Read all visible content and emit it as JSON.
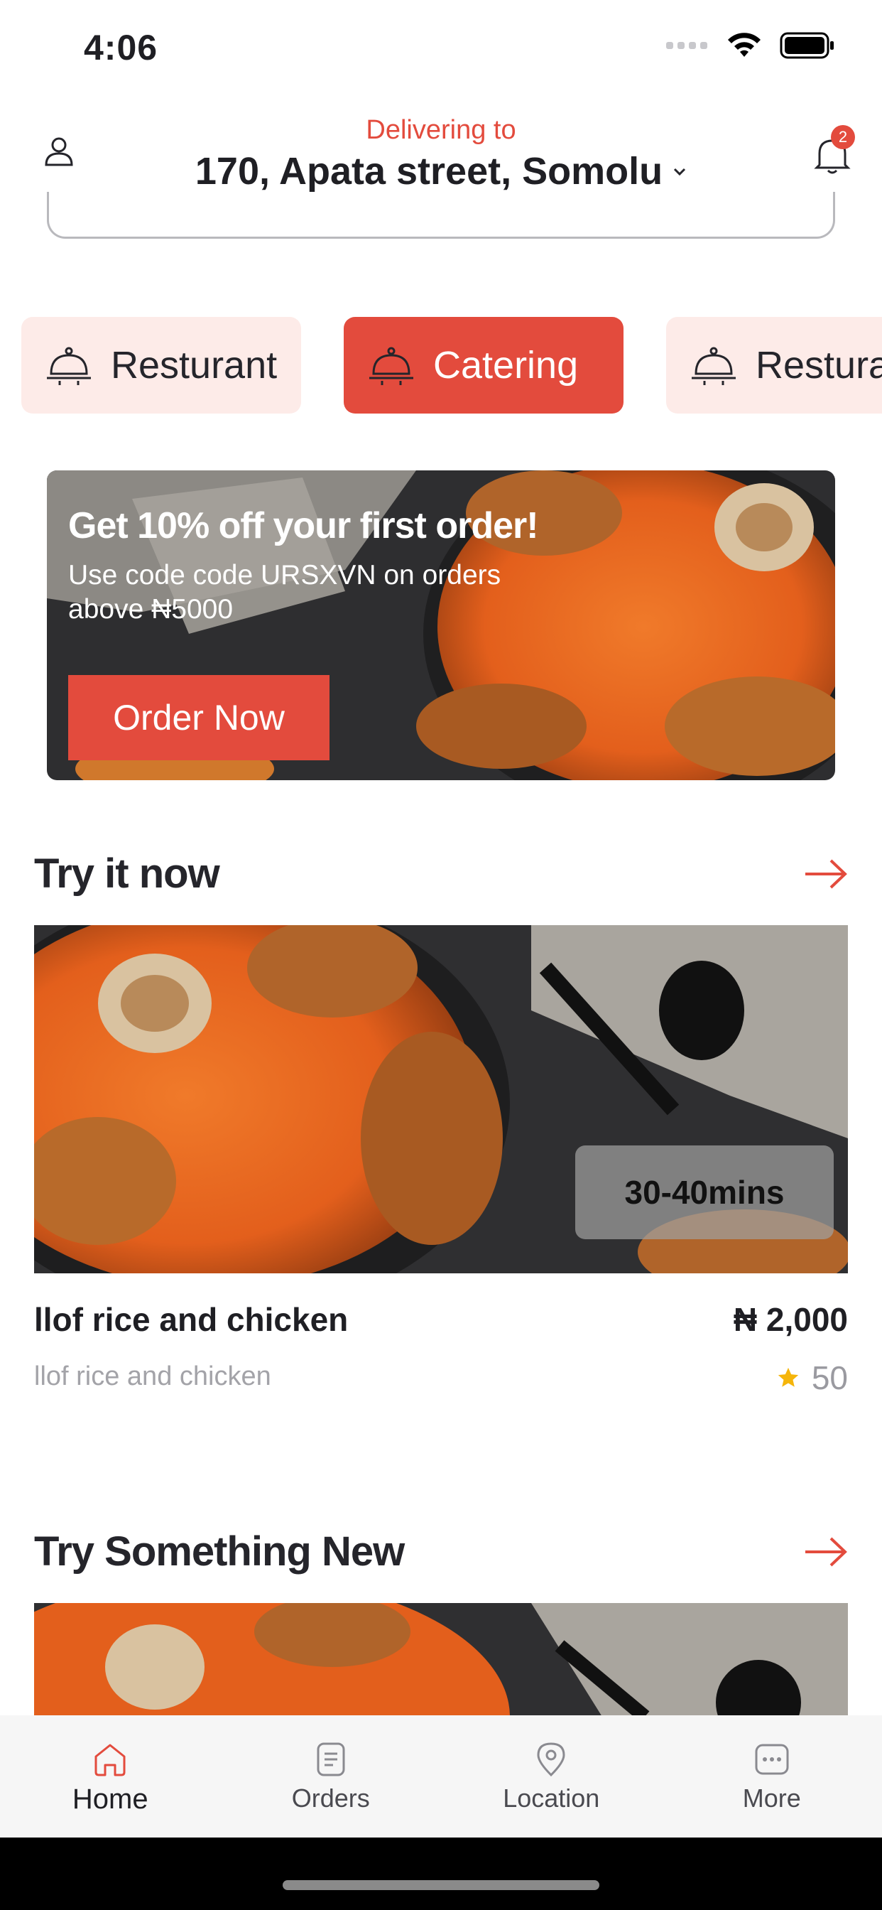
{
  "status_bar": {
    "time": "4:06"
  },
  "header": {
    "delivering_label": "Delivering to",
    "address": "170, Apata street, Somolu",
    "notification_count": "2"
  },
  "categories": [
    {
      "label": "Resturant",
      "active": false
    },
    {
      "label": "Catering",
      "active": true
    },
    {
      "label": "Resturant",
      "active": false
    }
  ],
  "promo": {
    "title": "Get 10% off your first order!",
    "subtitle": "Use code code URSXVN on orders above ₦5000",
    "button_label": "Order Now"
  },
  "sections": {
    "try_now_title": "Try it now",
    "try_new_title": "Try Something New"
  },
  "featured_item": {
    "delivery_time": "30-40mins",
    "name": "llof rice and chicken",
    "description": "llof rice and chicken",
    "price": "₦ 2,000",
    "rating": "50"
  },
  "bottom_nav": [
    {
      "label": "Home",
      "icon": "home-icon",
      "active": true
    },
    {
      "label": "Orders",
      "icon": "orders-icon",
      "active": false
    },
    {
      "label": "Location",
      "icon": "location-icon",
      "active": false
    },
    {
      "label": "More",
      "icon": "more-icon",
      "active": false
    }
  ],
  "colors": {
    "accent": "#e34b3d",
    "chip_bg": "#fdebe8",
    "star": "#f5b50a"
  }
}
